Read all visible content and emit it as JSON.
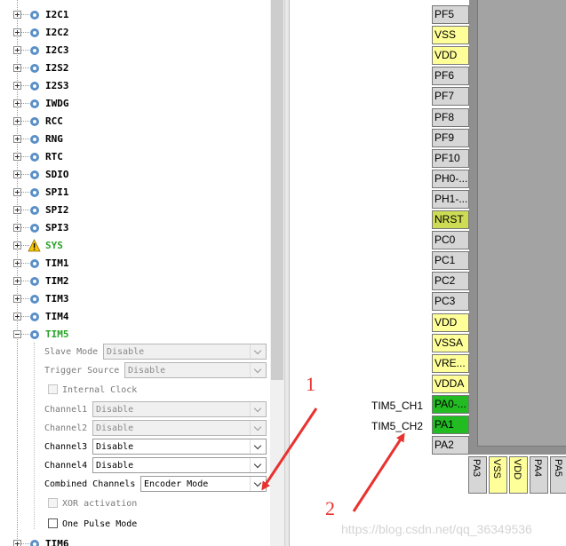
{
  "tree": {
    "peripherals": [
      {
        "name": "I2C1"
      },
      {
        "name": "I2C2"
      },
      {
        "name": "I2C3"
      },
      {
        "name": "I2S2"
      },
      {
        "name": "I2S3"
      },
      {
        "name": "IWDG"
      },
      {
        "name": "RCC"
      },
      {
        "name": "RNG"
      },
      {
        "name": "RTC"
      },
      {
        "name": "SDIO"
      },
      {
        "name": "SPI1"
      },
      {
        "name": "SPI2"
      },
      {
        "name": "SPI3"
      },
      {
        "name": "SYS",
        "warning": true
      },
      {
        "name": "TIM1"
      },
      {
        "name": "TIM2"
      },
      {
        "name": "TIM3"
      },
      {
        "name": "TIM4"
      },
      {
        "name": "TIM5",
        "expanded": true,
        "active": true
      }
    ],
    "tim5_settings": {
      "slave_mode": {
        "label": "Slave Mode",
        "value": "Disable"
      },
      "trigger_source": {
        "label": "Trigger Source",
        "value": "Disable"
      },
      "internal_clock": {
        "label": "Internal Clock"
      },
      "channel1": {
        "label": "Channel1",
        "value": "Disable"
      },
      "channel2": {
        "label": "Channel2",
        "value": "Disable"
      },
      "channel3": {
        "label": "Channel3",
        "value": "Disable"
      },
      "channel4": {
        "label": "Channel4",
        "value": "Disable"
      },
      "combined_channels": {
        "label": "Combined Channels",
        "value": "Encoder Mode"
      },
      "xor_activation": {
        "label": "XOR activation"
      },
      "one_pulse_mode": {
        "label": "One Pulse Mode"
      }
    },
    "next_item": "TIM6"
  },
  "chip": {
    "left_pins": [
      {
        "label": "PF5",
        "color": "#d6d6d6"
      },
      {
        "label": "VSS",
        "color": "#ffff99"
      },
      {
        "label": "VDD",
        "color": "#ffff99"
      },
      {
        "label": "PF6",
        "color": "#d6d6d6"
      },
      {
        "label": "PF7",
        "color": "#d6d6d6"
      },
      {
        "label": "PF8",
        "color": "#d6d6d6"
      },
      {
        "label": "PF9",
        "color": "#d6d6d6"
      },
      {
        "label": "PF10",
        "color": "#d6d6d6"
      },
      {
        "label": "PH0-...",
        "color": "#d6d6d6"
      },
      {
        "label": "PH1-...",
        "color": "#d6d6d6"
      },
      {
        "label": "NRST",
        "color": "#cddc54"
      },
      {
        "label": "PC0",
        "color": "#d6d6d6"
      },
      {
        "label": "PC1",
        "color": "#d6d6d6"
      },
      {
        "label": "PC2",
        "color": "#d6d6d6"
      },
      {
        "label": "PC3",
        "color": "#d6d6d6"
      },
      {
        "label": "VDD",
        "color": "#ffff99"
      },
      {
        "label": "VSSA",
        "color": "#ffff99"
      },
      {
        "label": "VRE...",
        "color": "#ffff99"
      },
      {
        "label": "VDDA",
        "color": "#ffff99"
      },
      {
        "label": "PA0-...",
        "color": "#22bb22"
      },
      {
        "label": "PA1",
        "color": "#22bb22"
      },
      {
        "label": "PA2",
        "color": "#d6d6d6"
      }
    ],
    "bottom_pins": [
      {
        "label": "PA3",
        "color": "#d6d6d6"
      },
      {
        "label": "VSS",
        "color": "#ffff99"
      },
      {
        "label": "VDD",
        "color": "#ffff99"
      },
      {
        "label": "PA4",
        "color": "#d6d6d6"
      },
      {
        "label": "PA5",
        "color": "#d6d6d6"
      }
    ],
    "signals": [
      "TIM5_CH1",
      "TIM5_CH2"
    ]
  },
  "annotations": {
    "mark1": "1",
    "mark2": "2",
    "arrow_color": "#e8322f"
  },
  "watermark": "https://blog.csdn.net/qq_36349536"
}
